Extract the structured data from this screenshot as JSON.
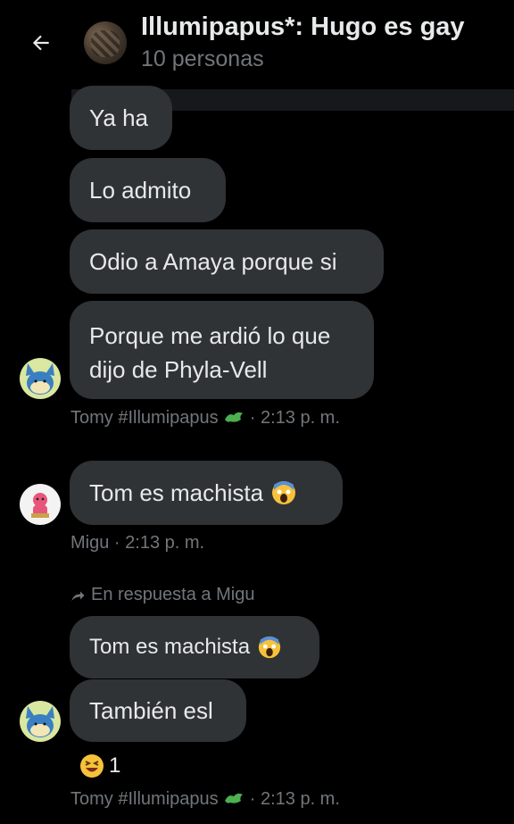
{
  "header": {
    "title": "Illumipapus*: Hugo es gay",
    "subtitle": "10 personas"
  },
  "messages": [
    {
      "text": "Ya ha"
    },
    {
      "text": "Lo admito"
    },
    {
      "text": "Odio a Amaya porque si"
    },
    {
      "text": "Porque me ardió lo que dijo de Phyla-Vell"
    },
    {
      "text": "Tom es machista"
    },
    {
      "text": "Tom es machista"
    },
    {
      "text": "También esl"
    }
  ],
  "meta": {
    "tomy_1": "Tomy #Illumipapus",
    "time_1": "· 2:13 p. m.",
    "migu": "Migu",
    "time_2": "· 2:13 p. m.",
    "reply_to": "En respuesta a Migu",
    "tomy_2": "Tomy #Illumipapus",
    "time_3": "· 2:13 p. m."
  },
  "reaction": {
    "count": "1"
  }
}
